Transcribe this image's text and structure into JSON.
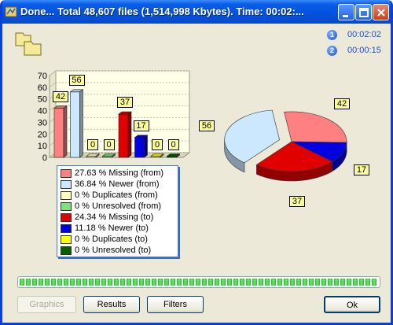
{
  "window": {
    "title": "Done... Total 48,607 files (1,514,998 Kbytes).  Time: 00:02:...",
    "buttons": {
      "minimize": "minimize",
      "maximize": "maximize",
      "close": "close"
    }
  },
  "timers": [
    {
      "badge": "1",
      "value": "00:02:02"
    },
    {
      "badge": "2",
      "value": "00:00:15"
    }
  ],
  "chart_data": [
    {
      "type": "bar",
      "categories": [
        "Missing (from)",
        "Newer (from)",
        "Duplicates (from)",
        "Unresolved (from)",
        "Missing (to)",
        "Newer (to)",
        "Duplicates (to)",
        "Unresolved (to)"
      ],
      "values": [
        42,
        56,
        0,
        0,
        37,
        17,
        0,
        0
      ],
      "value_labels": [
        "42",
        "56",
        "0",
        "0",
        "37",
        "17",
        "0",
        "0"
      ],
      "colors": [
        "#ff8080",
        "#cce8ff",
        "#ffffc0",
        "#80e080",
        "#e00000",
        "#0000e0",
        "#ffff00",
        "#006000"
      ],
      "y_ticks": [
        "0",
        "10",
        "20",
        "30",
        "40",
        "50",
        "60",
        "70"
      ],
      "ylim": [
        0,
        70
      ],
      "grid": true
    },
    {
      "type": "pie",
      "labels": [
        "56",
        "42",
        "17",
        "37"
      ],
      "values": [
        56,
        42,
        17,
        37
      ],
      "colors": [
        "#cce8ff",
        "#ff8080",
        "#0000e0",
        "#e00000"
      ]
    }
  ],
  "legend": [
    {
      "color": "#ff8080",
      "text": "27.63 % Missing (from)"
    },
    {
      "color": "#cce8ff",
      "text": "36.84 % Newer (from)"
    },
    {
      "color": "#ffffc0",
      "text": "0 % Duplicates (from)"
    },
    {
      "color": "#80e080",
      "text": "0 % Unresolved (from)"
    },
    {
      "color": "#e00000",
      "text": "24.34 % Missing (to)"
    },
    {
      "color": "#0000e0",
      "text": "11.18 % Newer (to)"
    },
    {
      "color": "#ffff00",
      "text": "0 % Duplicates (to)"
    },
    {
      "color": "#006000",
      "text": "0 % Unresolved (to)"
    }
  ],
  "progress": {
    "value": 1.0
  },
  "footer": {
    "graphics": "Graphics",
    "results": "Results",
    "filters": "Filters",
    "ok": "Ok"
  }
}
